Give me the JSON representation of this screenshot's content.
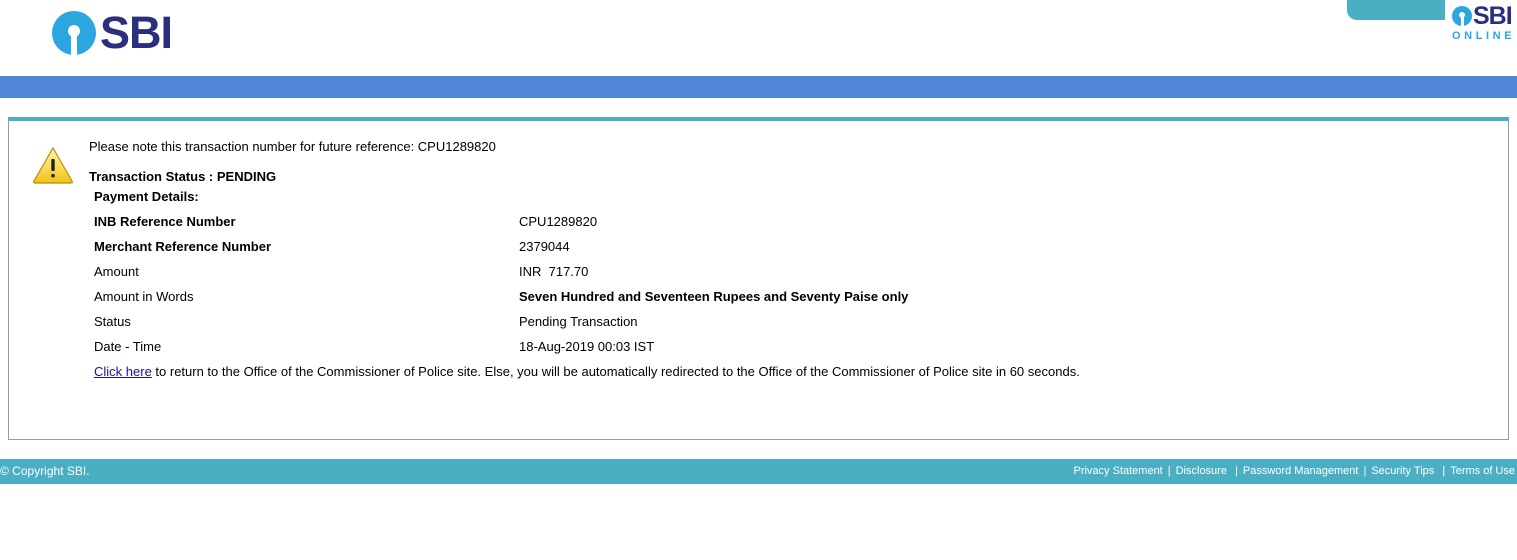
{
  "header": {
    "logo_text": "SBI",
    "online_logo_text": "SBI",
    "online_logo_sub": "ONLINE"
  },
  "colors": {
    "brand_blue": "#2ba6de",
    "brand_navy": "#2c2f7e",
    "bar_blue": "#5287d8",
    "teal": "#4bafc4"
  },
  "alert": {
    "icon": "warning-icon",
    "note": "Please note this transaction number for future reference: CPU1289820",
    "status_label": "Transaction Status : ",
    "status_value": "PENDING"
  },
  "payment": {
    "title": "Payment Details:",
    "rows": [
      {
        "label": "INB Reference Number",
        "value": "CPU1289820"
      },
      {
        "label": "Merchant Reference Number",
        "value": "2379044"
      },
      {
        "label": "Amount",
        "value": "INR  717.70"
      },
      {
        "label": "Amount in Words",
        "value": "Seven Hundred and Seventeen Rupees and Seventy Paise only"
      },
      {
        "label": "Status",
        "value": "Pending Transaction"
      },
      {
        "label": "Date - Time",
        "value": "18-Aug-2019 00:03 IST"
      }
    ]
  },
  "redirect": {
    "link_text": "Click here",
    "message": " to return to the Office of the Commissioner of Police site. Else, you will be automatically redirected to the Office of the Commissioner of Police site in 60 seconds."
  },
  "footer": {
    "copyright": "© Copyright SBI.",
    "links": [
      "Privacy Statement",
      "Disclosure",
      "Password Management",
      "Security Tips",
      "Terms of Use"
    ]
  }
}
